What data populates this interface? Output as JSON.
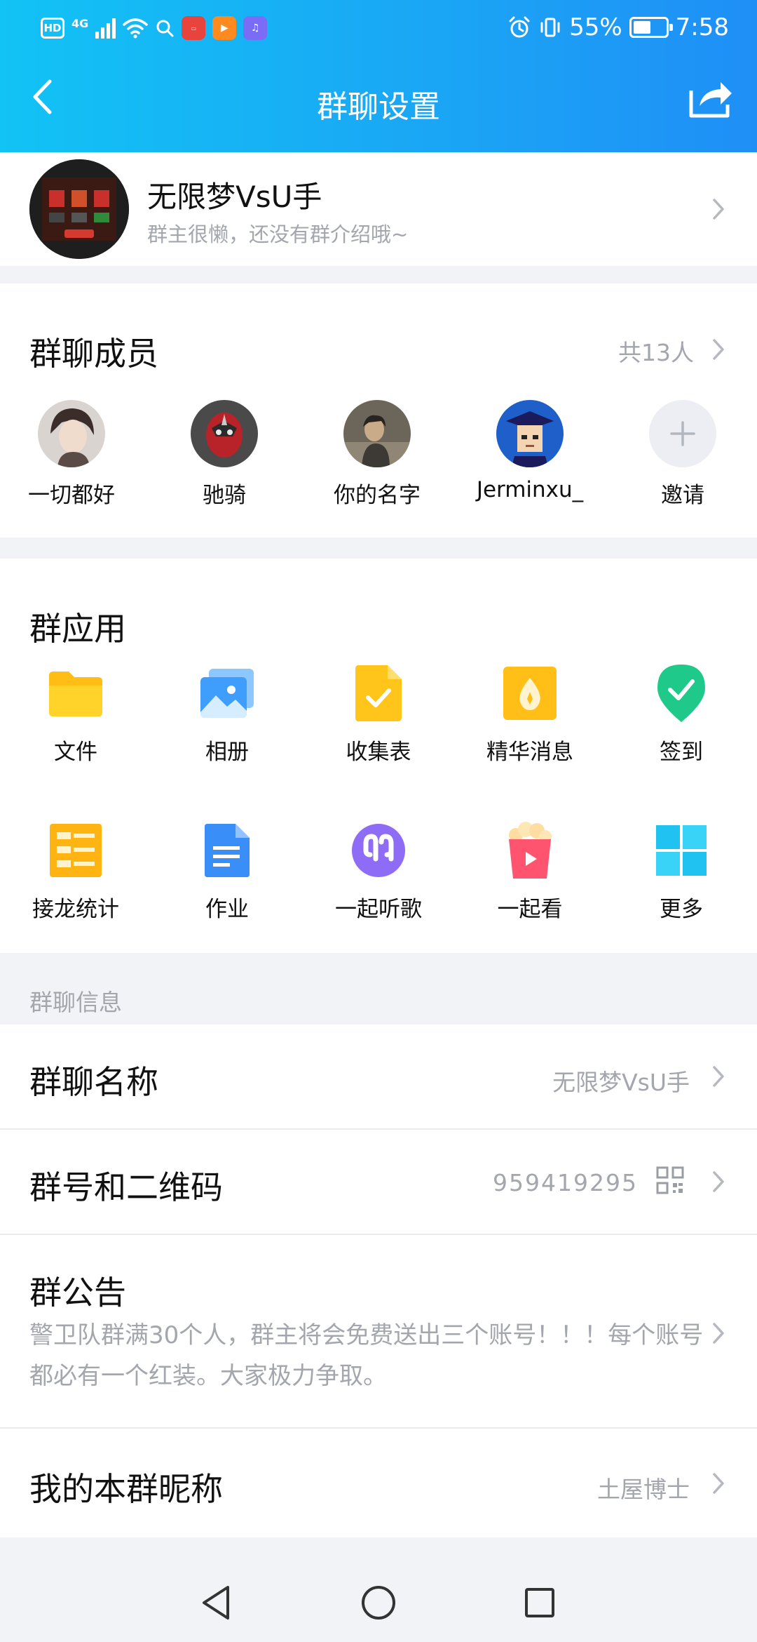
{
  "status_bar": {
    "hd": "HD",
    "network": "4G",
    "battery_pct": "55%",
    "battery_level": 0.55,
    "time": "7:58"
  },
  "nav": {
    "title": "群聊设置",
    "back_icon": "chevron-left-icon",
    "share_icon": "share-icon"
  },
  "group": {
    "name": "无限梦VsU手",
    "description": "群主很懒，还没有群介绍哦~"
  },
  "members": {
    "title": "群聊成员",
    "count": "共13人",
    "list": [
      {
        "name": "一切都好"
      },
      {
        "name": "驰骑"
      },
      {
        "name": "你的名字"
      },
      {
        "name": "Jerminxu_"
      },
      {
        "name": "邀请"
      }
    ]
  },
  "apps": {
    "title": "群应用",
    "items": [
      {
        "label": "文件",
        "icon": "folder-icon"
      },
      {
        "label": "相册",
        "icon": "album-icon"
      },
      {
        "label": "收集表",
        "icon": "form-icon"
      },
      {
        "label": "精华消息",
        "icon": "essence-icon"
      },
      {
        "label": "签到",
        "icon": "checkin-icon"
      },
      {
        "label": "接龙统计",
        "icon": "relay-icon"
      },
      {
        "label": "作业",
        "icon": "homework-icon"
      },
      {
        "label": "一起听歌",
        "icon": "headphones-icon"
      },
      {
        "label": "一起看",
        "icon": "popcorn-icon"
      },
      {
        "label": "更多",
        "icon": "more-grid-icon"
      }
    ]
  },
  "info": {
    "section_label": "群聊信息",
    "group_name_label": "群聊名称",
    "group_name_value": "无限梦VsU手",
    "group_id_label": "群号和二维码",
    "group_id_value": "959419295",
    "notice_label": "群公告",
    "notice_text": "警卫队群满30个人，群主将会免费送出三个账号！！！每个账号都必有一个红装。大家极力争取。",
    "nickname_label": "我的本群昵称",
    "nickname_value": "土屋博士"
  },
  "colors": {
    "header_start": "#12c3f5",
    "header_end": "#1f8ff6",
    "muted_text": "#a3a6ad",
    "page_bg": "#f2f3f7"
  }
}
